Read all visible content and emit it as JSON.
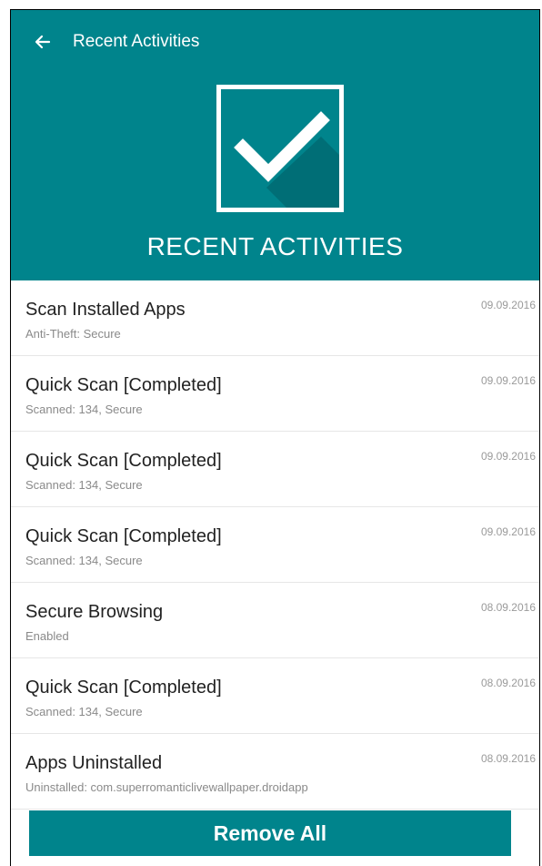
{
  "header": {
    "title": "Recent Activities",
    "hero_text": "RECENT ACTIVITIES",
    "back_icon": "arrow-left-icon",
    "hero_icon": "checkmark-icon"
  },
  "activities": [
    {
      "title": "Scan Installed Apps",
      "subtitle": "Anti-Theft: Secure",
      "date": "09.09.2016"
    },
    {
      "title": "Quick Scan [Completed]",
      "subtitle": "Scanned: 134, Secure",
      "date": "09.09.2016"
    },
    {
      "title": "Quick Scan [Completed]",
      "subtitle": "Scanned: 134, Secure",
      "date": "09.09.2016"
    },
    {
      "title": "Quick Scan [Completed]",
      "subtitle": "Scanned: 134, Secure",
      "date": "09.09.2016"
    },
    {
      "title": "Secure Browsing",
      "subtitle": "Enabled",
      "date": "08.09.2016"
    },
    {
      "title": "Quick Scan [Completed]",
      "subtitle": "Scanned: 134, Secure",
      "date": "08.09.2016"
    },
    {
      "title": "Apps Uninstalled",
      "subtitle": "Uninstalled: com.superromanticlivewallpaper.droidapp",
      "date": "08.09.2016"
    }
  ],
  "footer": {
    "remove_all_label": "Remove All"
  },
  "colors": {
    "primary": "#00848C",
    "text": "#222222",
    "subtext": "#8a8a8a"
  }
}
